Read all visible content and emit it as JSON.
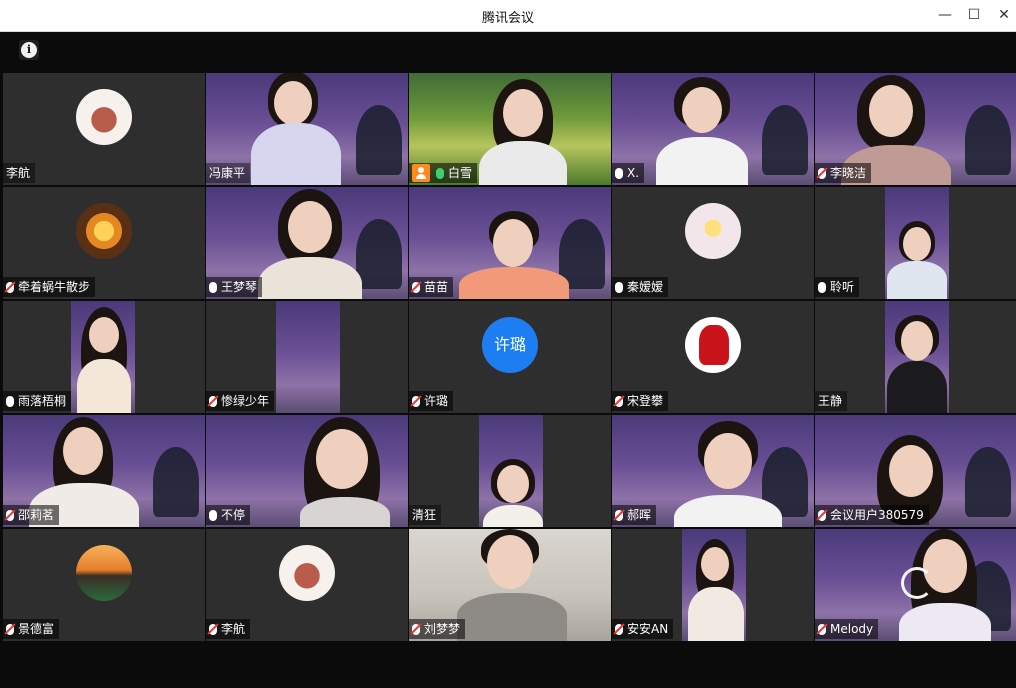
{
  "window": {
    "title": "腾讯会议",
    "minimize": "—",
    "maximize": "☐",
    "close": "✕"
  },
  "toolbar": {
    "info_icon": "i"
  },
  "colors": {
    "active_speaker_border": "#2fcf6a",
    "host_badge": "#ff8a1c",
    "mic_active": "#3bd16f",
    "tile_bg": "#2e2e2e"
  },
  "participants": [
    {
      "name": "李航",
      "mic": "none",
      "type": "avatar-photo"
    },
    {
      "name": "冯康平",
      "mic": "none",
      "type": "video"
    },
    {
      "name": "白雪",
      "mic": "active",
      "type": "video",
      "host": true,
      "active": true
    },
    {
      "name": "X.",
      "mic": "on",
      "type": "video"
    },
    {
      "name": "李晓洁",
      "mic": "muted",
      "type": "video"
    },
    {
      "name": "牵着蜗牛散步",
      "mic": "muted",
      "type": "avatar-photo"
    },
    {
      "name": "王梦琴",
      "mic": "on",
      "type": "video"
    },
    {
      "name": "苗苗",
      "mic": "muted",
      "type": "video"
    },
    {
      "name": "秦嫒嫒",
      "mic": "on",
      "type": "avatar-photo"
    },
    {
      "name": "聆听",
      "mic": "on",
      "type": "video"
    },
    {
      "name": "雨落梧桐",
      "mic": "on",
      "type": "video"
    },
    {
      "name": "惨绿少年",
      "mic": "muted",
      "type": "video"
    },
    {
      "name": "许璐",
      "mic": "muted",
      "type": "avatar-initials",
      "initials": "许璐"
    },
    {
      "name": "宋登攀",
      "mic": "muted",
      "type": "avatar-photo"
    },
    {
      "name": "王静",
      "mic": "none",
      "type": "video"
    },
    {
      "name": "邵莉茗",
      "mic": "muted",
      "type": "video"
    },
    {
      "name": "不停",
      "mic": "on",
      "type": "video"
    },
    {
      "name": "清狂",
      "mic": "none",
      "type": "video"
    },
    {
      "name": "郝晖",
      "mic": "muted",
      "type": "video"
    },
    {
      "name": "会议用户380579",
      "mic": "muted",
      "type": "video"
    },
    {
      "name": "景德富",
      "mic": "muted",
      "type": "avatar-photo"
    },
    {
      "name": "李航",
      "mic": "muted",
      "type": "avatar-photo"
    },
    {
      "name": "刘梦梦",
      "mic": "muted",
      "type": "video"
    },
    {
      "name": "安安AN",
      "mic": "muted",
      "type": "video"
    },
    {
      "name": "Melody",
      "mic": "muted",
      "type": "video"
    }
  ]
}
